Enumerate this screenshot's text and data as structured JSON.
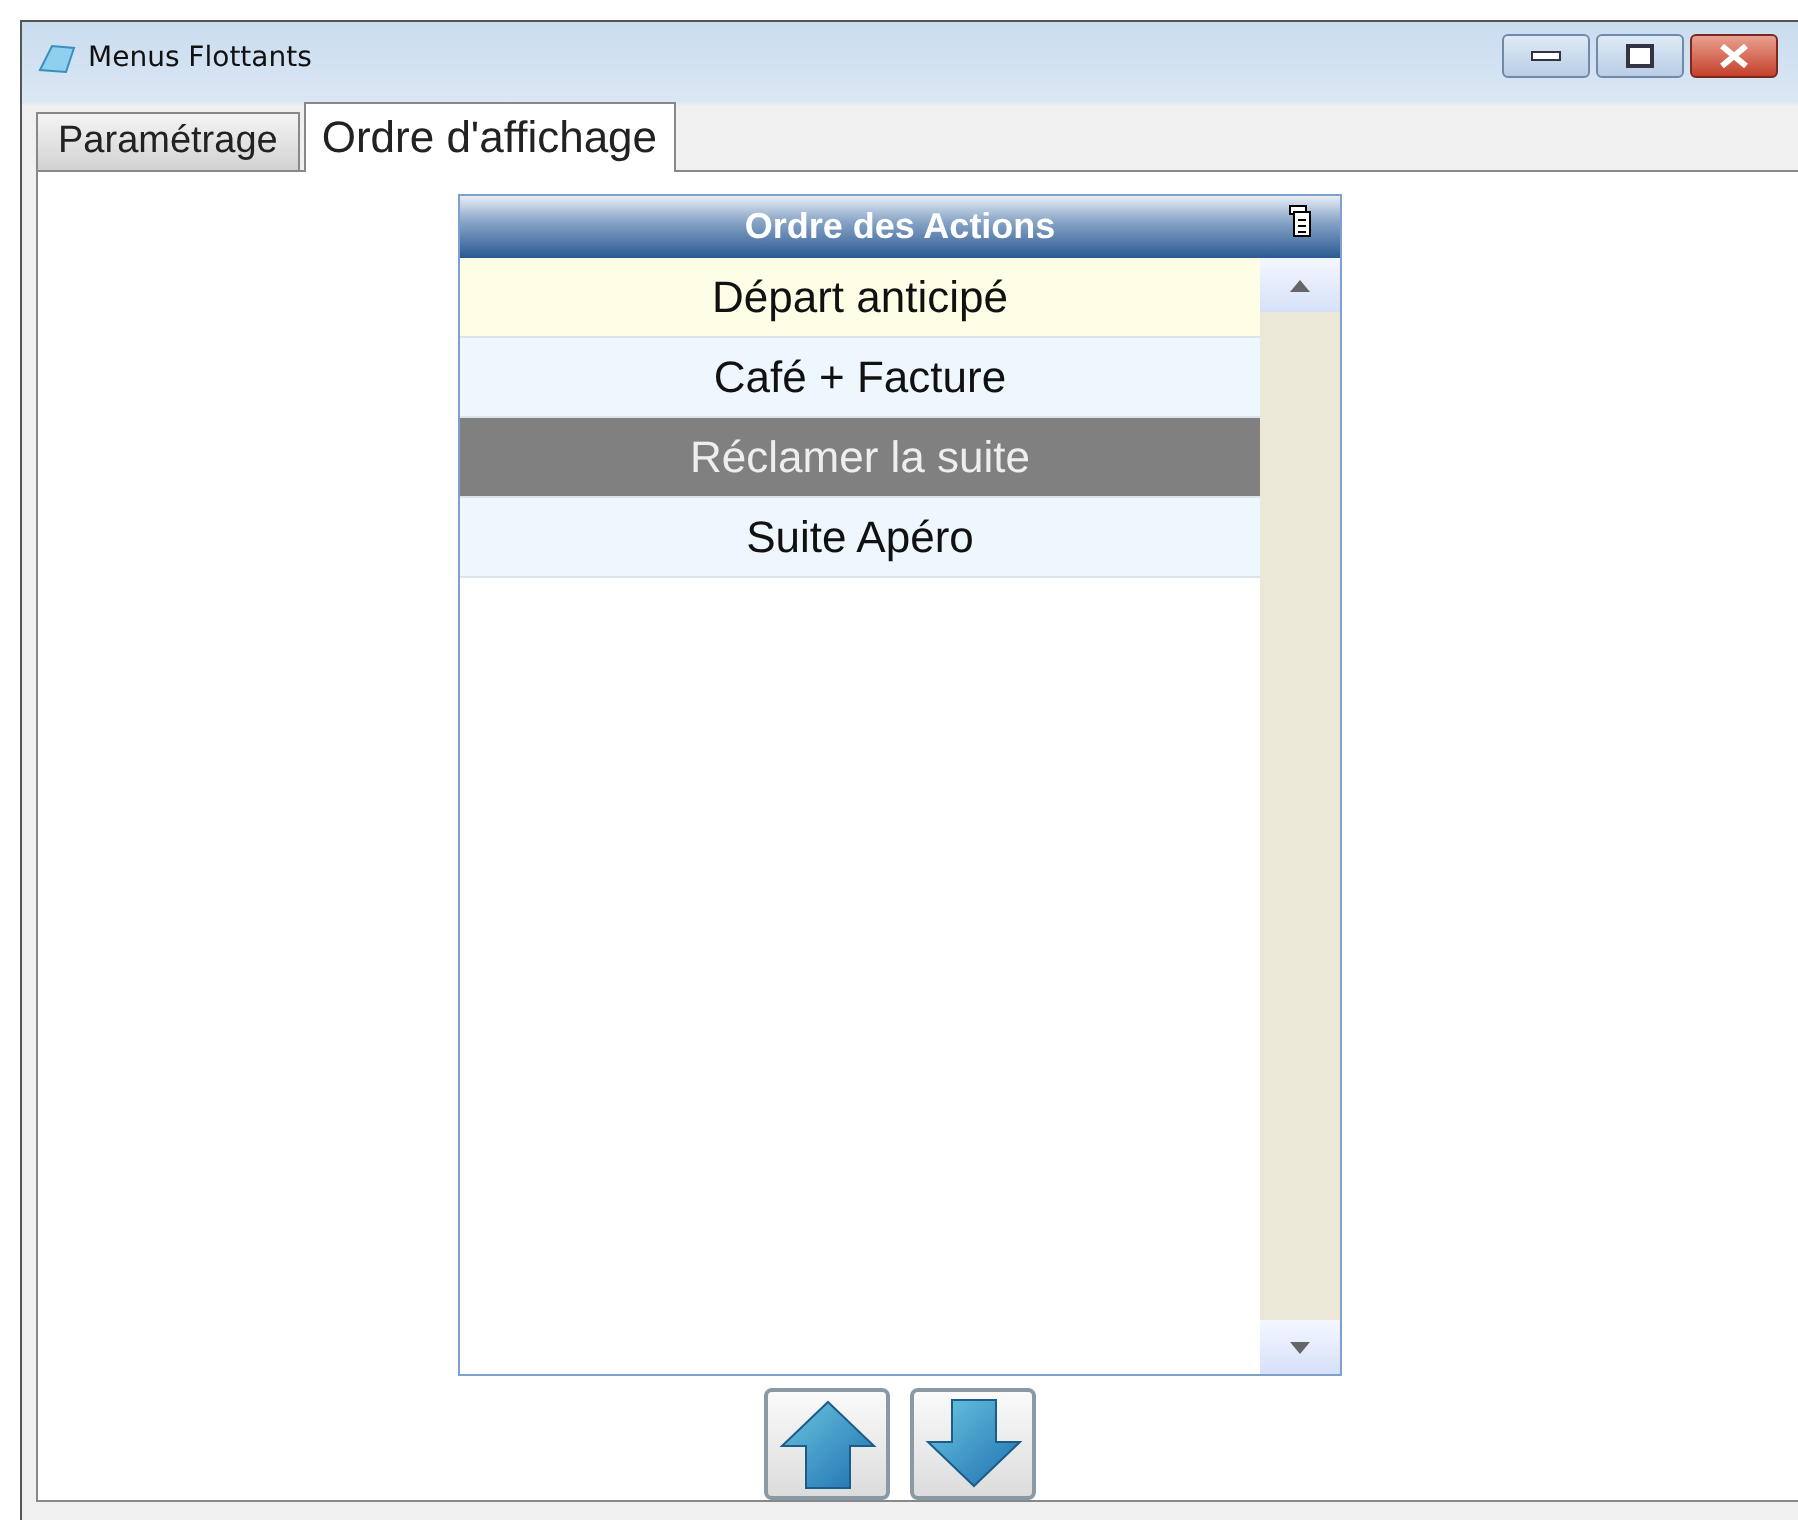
{
  "window": {
    "title": "Menus Flottants"
  },
  "tabs": [
    {
      "label": "Paramétrage",
      "selected": false
    },
    {
      "label": "Ordre d'affichage",
      "selected": true
    }
  ],
  "list": {
    "header": "Ordre des Actions",
    "items": [
      {
        "label": "Départ anticipé",
        "selected": false,
        "highlighted": true
      },
      {
        "label": "Café + Facture",
        "selected": false,
        "highlighted": false
      },
      {
        "label": "Réclamer la suite",
        "selected": true,
        "highlighted": false
      },
      {
        "label": "Suite Apéro",
        "selected": false,
        "highlighted": false
      }
    ]
  }
}
